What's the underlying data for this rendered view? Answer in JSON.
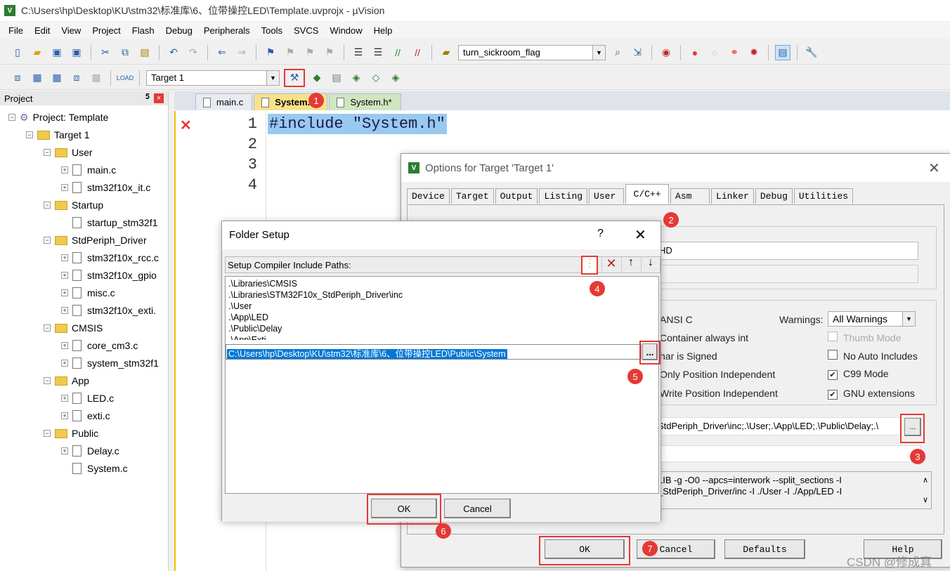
{
  "window": {
    "title": "C:\\Users\\hp\\Desktop\\KU\\stm32\\标准库\\6、位带操控LED\\Template.uvprojx - µVision",
    "app_icon": "V"
  },
  "menu": [
    "File",
    "Edit",
    "View",
    "Project",
    "Flash",
    "Debug",
    "Peripherals",
    "Tools",
    "SVCS",
    "Window",
    "Help"
  ],
  "toolbar": {
    "find_combo": "turn_sickroom_flag",
    "target_combo": "Target 1"
  },
  "project": {
    "title": "Project",
    "tree": [
      {
        "label": "Project: Template",
        "level": 0,
        "type": "root"
      },
      {
        "label": "Target 1",
        "level": 1,
        "type": "target"
      },
      {
        "label": "User",
        "level": 2,
        "type": "folder"
      },
      {
        "label": "main.c",
        "level": 3,
        "type": "file"
      },
      {
        "label": "stm32f10x_it.c",
        "level": 3,
        "type": "file"
      },
      {
        "label": "Startup",
        "level": 2,
        "type": "folder"
      },
      {
        "label": "startup_stm32f1",
        "level": 3,
        "type": "file",
        "noexp": true
      },
      {
        "label": "StdPeriph_Driver",
        "level": 2,
        "type": "folder"
      },
      {
        "label": "stm32f10x_rcc.c",
        "level": 3,
        "type": "file"
      },
      {
        "label": "stm32f10x_gpio",
        "level": 3,
        "type": "file"
      },
      {
        "label": "misc.c",
        "level": 3,
        "type": "file"
      },
      {
        "label": "stm32f10x_exti.",
        "level": 3,
        "type": "file"
      },
      {
        "label": "CMSIS",
        "level": 2,
        "type": "folder"
      },
      {
        "label": "core_cm3.c",
        "level": 3,
        "type": "file"
      },
      {
        "label": "system_stm32f1",
        "level": 3,
        "type": "file"
      },
      {
        "label": "App",
        "level": 2,
        "type": "folder"
      },
      {
        "label": "LED.c",
        "level": 3,
        "type": "file"
      },
      {
        "label": "exti.c",
        "level": 3,
        "type": "file"
      },
      {
        "label": "Public",
        "level": 2,
        "type": "folder"
      },
      {
        "label": "Delay.c",
        "level": 3,
        "type": "file"
      },
      {
        "label": "System.c",
        "level": 3,
        "type": "file",
        "noexp": true
      }
    ]
  },
  "editor": {
    "tabs": [
      "main.c",
      "System.c*",
      "System.h*"
    ],
    "line_numbers": [
      "1",
      "2",
      "3",
      "4"
    ],
    "code_line1": "#include \"System.h\""
  },
  "options": {
    "title": "Options for Target 'Target 1'",
    "tabs": [
      "Device",
      "Target",
      "Output",
      "Listing",
      "User",
      "C/C++",
      "Asm",
      "Linker",
      "Debug",
      "Utilities"
    ],
    "define_value": "HD",
    "ansi_c": "ANSI C",
    "container": "Container always int",
    "char_signed": "har is Signed",
    "ro_pi": "Only Position Independent",
    "rw_pi": "Write Position Independent",
    "warnings_label": "Warnings:",
    "warnings_value": "All Warnings",
    "checks": [
      {
        "label": "Thumb Mode",
        "checked": false,
        "disabled": true
      },
      {
        "label": "No Auto Includes",
        "checked": false
      },
      {
        "label": "C99 Mode",
        "checked": true
      },
      {
        "label": "GNU extensions",
        "checked": true
      }
    ],
    "include_paths": "StdPeriph_Driver\\inc;.\\User;.\\App\\LED;.\\Public\\Delay;.\\",
    "compiler_line1": "LIB -g -O0 --apcs=interwork --split_sections -I",
    "compiler_line2": "_StdPeriph_Driver/inc -I ./User -I ./App/LED -I",
    "browse": "...",
    "ok": "OK",
    "cancel": "Cancel",
    "defaults": "Defaults",
    "help": "Help"
  },
  "folder_setup": {
    "title": "Folder Setup",
    "help": "?",
    "label": "Setup Compiler Include Paths:",
    "paths": [
      ".\\Libraries\\CMSIS",
      ".\\Libraries\\STM32F10x_StdPeriph_Driver\\inc",
      ".\\User",
      ".\\App\\LED",
      ".\\Public\\Delay",
      ".\\App\\Exti"
    ],
    "editing_path": "C:\\Users\\hp\\Desktop\\KU\\stm32\\标准库\\6、位带操控LED\\Public\\System",
    "browse": "...",
    "ok": "OK",
    "cancel": "Cancel"
  },
  "markers": [
    "1",
    "2",
    "3",
    "4",
    "5",
    "6",
    "7"
  ],
  "watermark": "CSDN @修成真",
  "colors": {
    "highlight": "#0078d7",
    "annotation": "#e53935",
    "code_selection": "#99c9ef"
  }
}
